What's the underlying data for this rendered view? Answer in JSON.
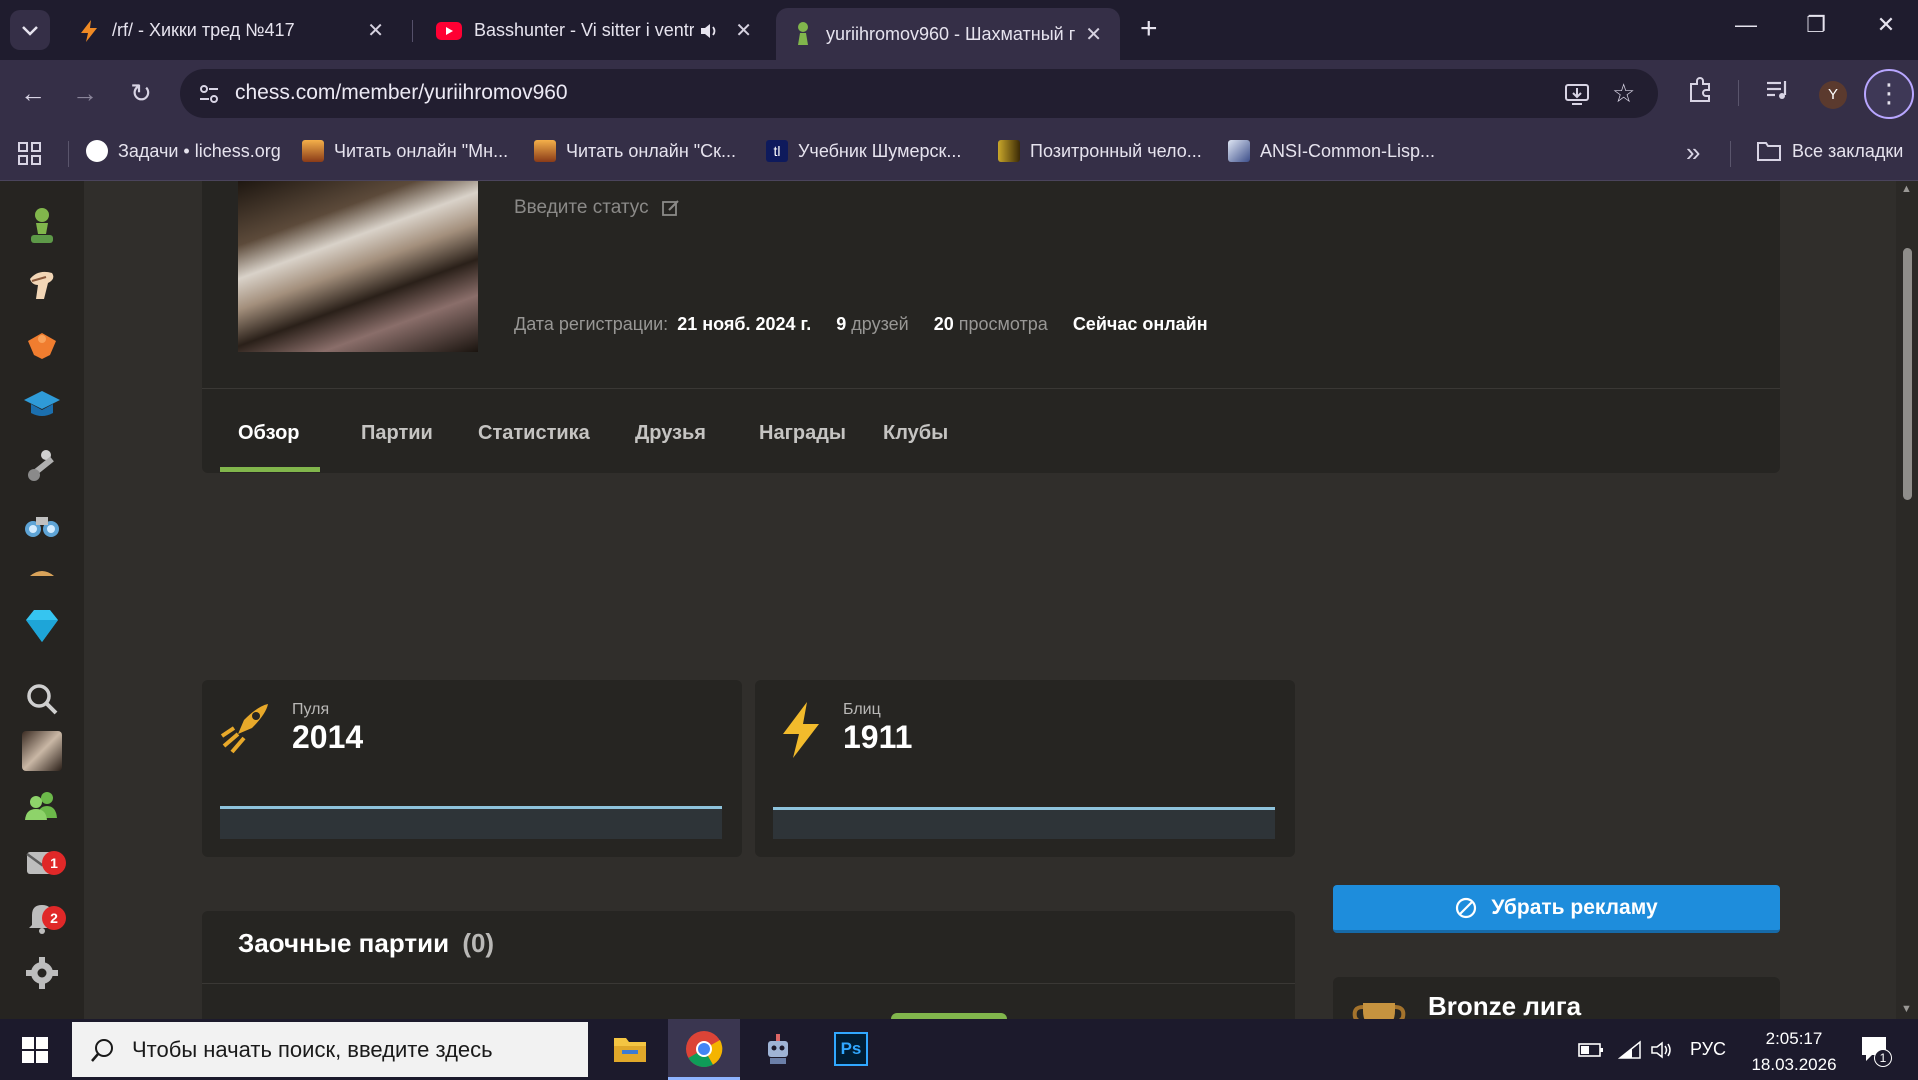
{
  "browser": {
    "tabs": [
      {
        "title": "/rf/ - Хикки тред №417",
        "icon": "bolt-icon",
        "active": false
      },
      {
        "title": "Basshunter - Vi sitter i ventr",
        "icon": "youtube-icon",
        "active": false
      },
      {
        "title": "yuriihromov960 - Шахматный г",
        "icon": "chess-pawn-icon",
        "active": true
      }
    ],
    "new_tab": "+",
    "url": "chess.com/member/yuriihromov960",
    "avatar_letter": "Y",
    "bookmarks": [
      {
        "label": "Задачи • lichess.org",
        "icon": "lichess-icon"
      },
      {
        "label": "Читать онлайн \"Мн...",
        "icon": "book-icon"
      },
      {
        "label": "Читать онлайн \"Ск...",
        "icon": "book-icon"
      },
      {
        "label": "Учебник Шумерск...",
        "icon": "tl-icon"
      },
      {
        "label": "Позитронный чело...",
        "icon": "book-icon"
      },
      {
        "label": "ANSI-Common-Lisp...",
        "icon": "lisp-icon"
      }
    ],
    "all_bookmarks": "Все закладки",
    "more_bookmarks": "»"
  },
  "profile": {
    "status_placeholder": "Введите статус",
    "registered_label": "Дата регистрации:",
    "registered_value": "21 нояб. 2024 г.",
    "friends_count": "9",
    "friends_label": "друзей",
    "views_count": "20",
    "views_label": "просмотра",
    "online": "Сейчас онлайн"
  },
  "profile_tabs": [
    "Обзор",
    "Партии",
    "Статистика",
    "Друзья",
    "Награды",
    "Клубы"
  ],
  "ratings": [
    {
      "label": "Пуля",
      "value": "2014",
      "icon": "bullet-icon"
    },
    {
      "label": "Блиц",
      "value": "1911",
      "icon": "blitz-icon"
    }
  ],
  "correspondence": {
    "title": "Заочные партии",
    "count": "(0)"
  },
  "remove_ads": "Убрать рекламу",
  "league": "Bronze лига",
  "leftnav_badges": {
    "messages": "1",
    "notifications": "2"
  },
  "taskbar": {
    "search_placeholder": "Чтобы начать поиск, введите здесь",
    "lang": "РУС",
    "time": "2:05:17",
    "date": "18.03.2026",
    "notif_count": "1"
  }
}
